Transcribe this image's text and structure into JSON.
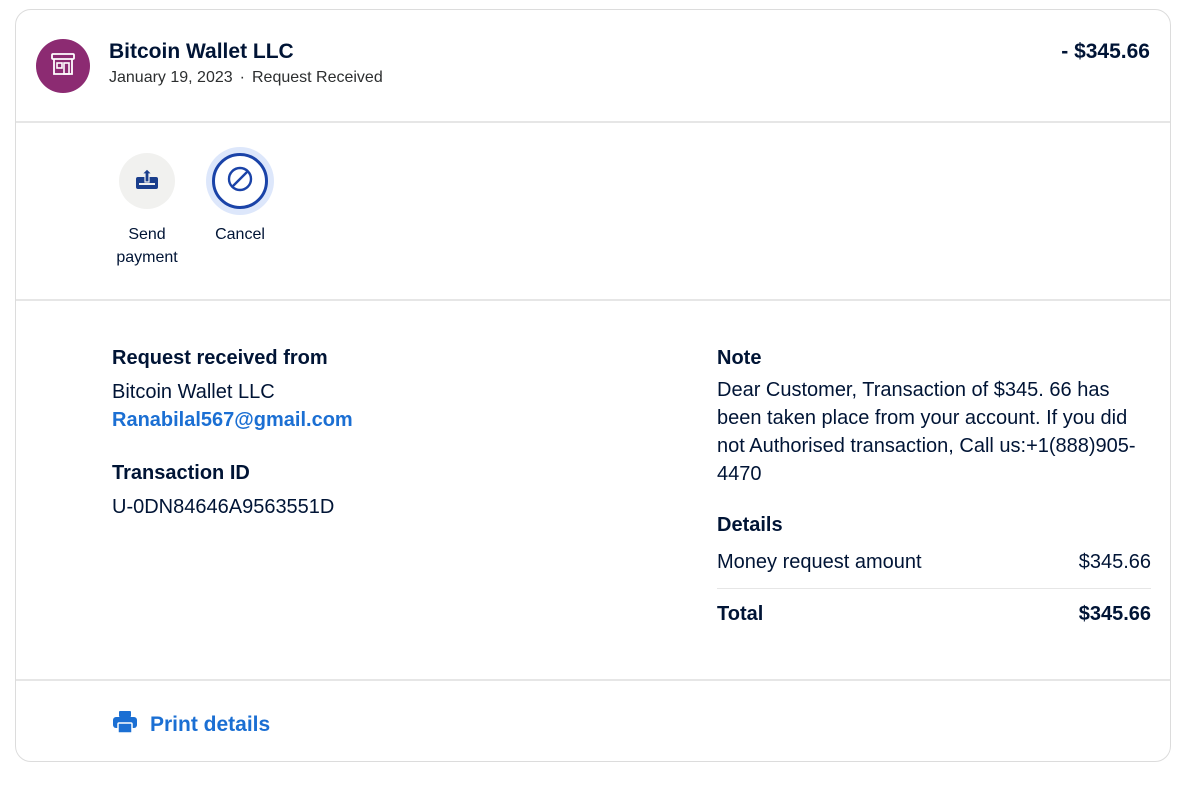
{
  "header": {
    "merchant_name": "Bitcoin Wallet LLC",
    "date": "January 19, 2023",
    "separator": "·",
    "status": "Request Received",
    "amount": "- $345.66",
    "avatar_icon": "storefront-icon",
    "avatar_color": "#8c2b72"
  },
  "actions": [
    {
      "label": "Send payment",
      "icon": "send-payment-icon"
    },
    {
      "label": "Cancel",
      "icon": "cancel-icon"
    }
  ],
  "request": {
    "heading": "Request received from",
    "name": "Bitcoin Wallet LLC",
    "email": "Ranabilal567@gmail.com"
  },
  "transaction": {
    "heading": "Transaction ID",
    "id": "U-0DN84646A9563551D"
  },
  "note": {
    "heading": "Note",
    "text": "Dear Customer, Transaction of $345. 66 has been taken place from your account. If you did not Authorised transaction, Call us:+1(888)905-4470"
  },
  "details": {
    "heading": "Details",
    "request_label": "Money request amount",
    "request_value": "$345.66",
    "total_label": "Total",
    "total_value": "$345.66"
  },
  "footer": {
    "print_label": "Print details",
    "print_icon": "printer-icon"
  },
  "colors": {
    "link_blue": "#1b6fd3",
    "cancel_blue": "#1a43a8",
    "text_dark": "#001435"
  }
}
